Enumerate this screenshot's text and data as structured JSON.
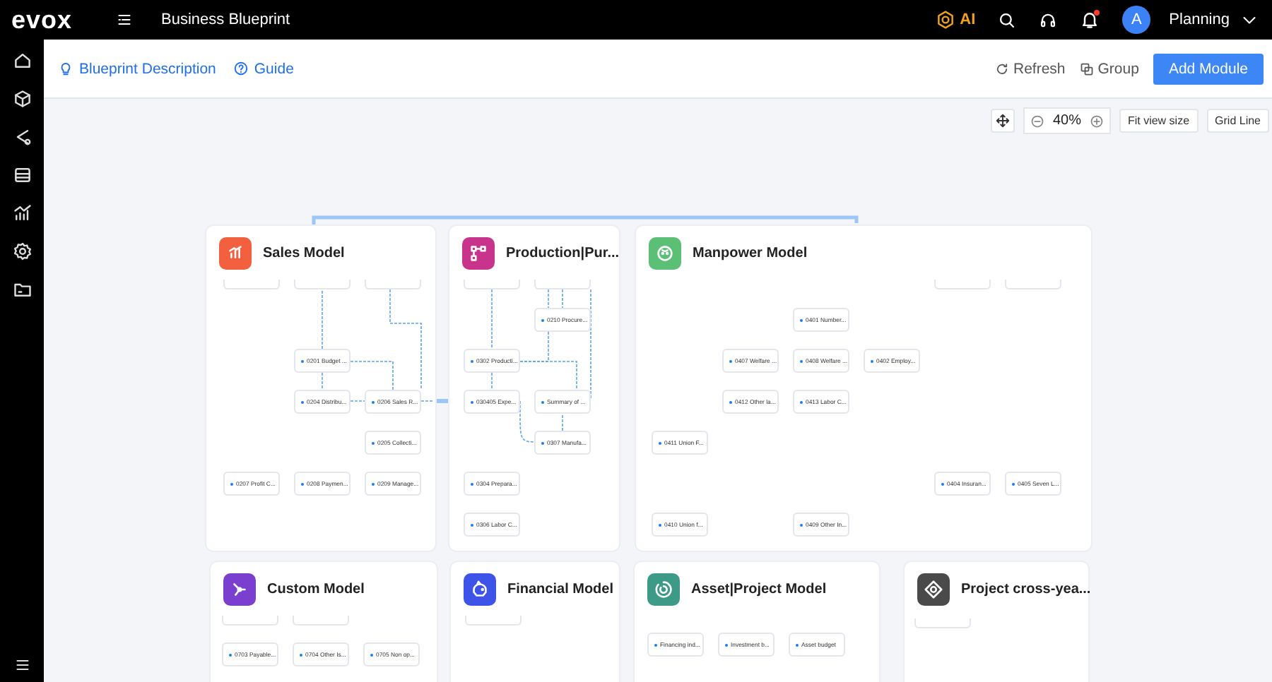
{
  "header": {
    "logo": "evox",
    "page_title": "Business Blueprint",
    "ai_label": "AI",
    "avatar_initial": "A",
    "user": "Planning"
  },
  "subbar": {
    "links": [
      "Blueprint Description",
      "Guide"
    ],
    "actions": [
      "Refresh",
      "Group"
    ],
    "primary": "Add Module"
  },
  "canvas_toolbar": {
    "zoom": "40%",
    "buttons": [
      "Fit view size",
      "Grid Line"
    ]
  },
  "modules": [
    {
      "title": "Sales Model",
      "color": "#f2603f",
      "nodes": [
        {
          "kind": "stub"
        },
        {
          "kind": "stub"
        },
        {
          "kind": "stub"
        },
        {
          "kind": "node",
          "label": "0201 Budget ..."
        },
        {
          "kind": "node",
          "label": "0204 Distribu..."
        },
        {
          "kind": "node",
          "label": "0206 Sales R..."
        },
        {
          "kind": "node",
          "label": "0205 Collecti..."
        },
        {
          "kind": "node",
          "label": "0207 Profit C..."
        },
        {
          "kind": "node",
          "label": "0208 Paymen..."
        },
        {
          "kind": "node",
          "label": "0209 Manage..."
        }
      ]
    },
    {
      "title": "Production|Pur...",
      "color": "#c8338c",
      "nodes": [
        {
          "kind": "stub"
        },
        {
          "kind": "stub"
        },
        {
          "kind": "node",
          "label": "0210 Procure..."
        },
        {
          "kind": "node",
          "label": "0302 Producti..."
        },
        {
          "kind": "node",
          "label": "030405 Expe..."
        },
        {
          "kind": "node",
          "label": "Summary of ..."
        },
        {
          "kind": "node",
          "label": "0307 Manufa..."
        },
        {
          "kind": "node",
          "label": "0304 Prepara..."
        },
        {
          "kind": "node",
          "label": "0306 Labor C..."
        }
      ]
    },
    {
      "title": "Manpower Model",
      "color": "#5cbf76",
      "nodes": [
        {
          "kind": "stub"
        },
        {
          "kind": "stub"
        },
        {
          "kind": "node",
          "label": "0401 Number..."
        },
        {
          "kind": "node",
          "label": "0407 Welfare ..."
        },
        {
          "kind": "node",
          "label": "0408 Welfare ..."
        },
        {
          "kind": "node",
          "label": "0402 Employ..."
        },
        {
          "kind": "node",
          "label": "0412 Other la..."
        },
        {
          "kind": "node",
          "label": "0413 Labor C..."
        },
        {
          "kind": "node",
          "label": "0411 Union F..."
        },
        {
          "kind": "node",
          "label": "0404 Insuran..."
        },
        {
          "kind": "node",
          "label": "0405 Seven L..."
        },
        {
          "kind": "node",
          "label": "0410 Union f..."
        },
        {
          "kind": "node",
          "label": "0409 Other In..."
        }
      ]
    },
    {
      "title": "Custom Model",
      "color": "#7b3fcf",
      "nodes": [
        {
          "kind": "stub"
        },
        {
          "kind": "stub"
        },
        {
          "kind": "node",
          "label": "0703 Payable..."
        },
        {
          "kind": "node",
          "label": "0704 Other Is..."
        },
        {
          "kind": "node",
          "label": "0705 Non op..."
        }
      ]
    },
    {
      "title": "Financial Model",
      "color": "#3e54e8",
      "nodes": [
        {
          "kind": "stub"
        }
      ]
    },
    {
      "title": "Asset|Project Model",
      "color": "#3d9a86",
      "nodes": [
        {
          "kind": "node",
          "label": "Financing ind..."
        },
        {
          "kind": "node",
          "label": "Investment b..."
        },
        {
          "kind": "node",
          "label": "Asset budget"
        }
      ]
    },
    {
      "title": "Project cross-yea...",
      "color": "#4a4a4a",
      "nodes": [
        {
          "kind": "stub"
        }
      ]
    }
  ]
}
